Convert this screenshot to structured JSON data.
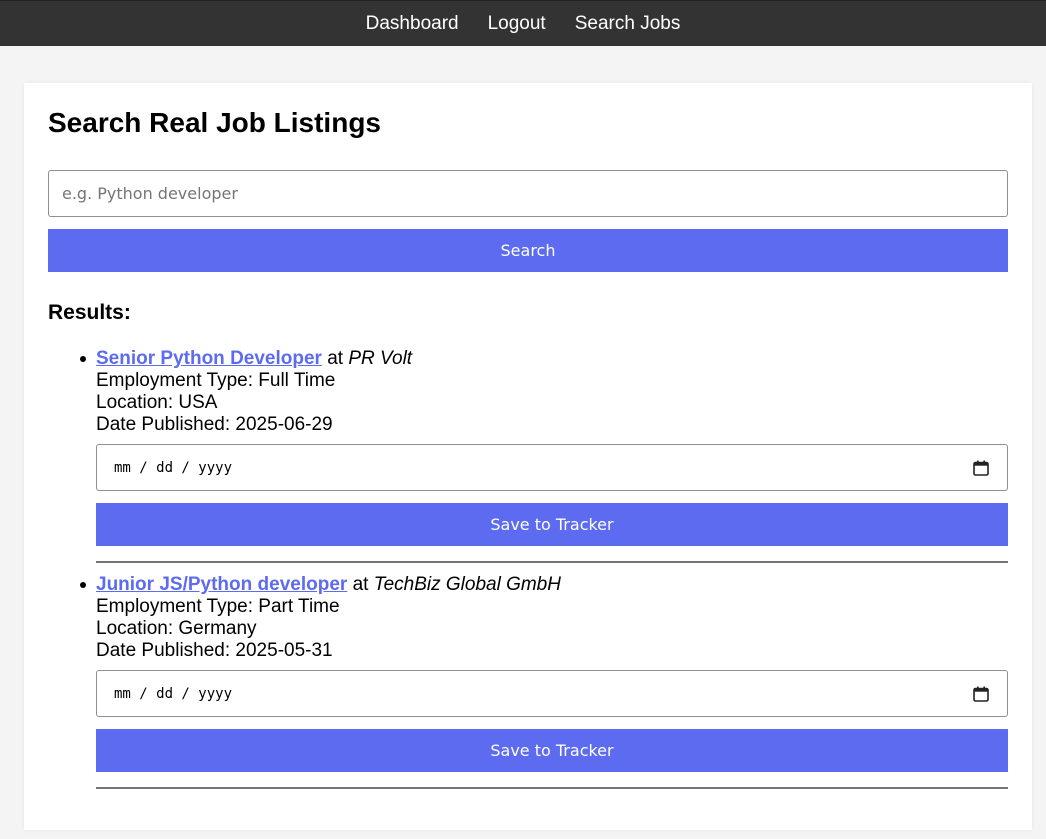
{
  "nav": {
    "dashboard": "Dashboard",
    "logout": "Logout",
    "search_jobs": "Search Jobs"
  },
  "page": {
    "title": "Search Real Job Listings",
    "search_placeholder": "e.g. Python developer",
    "search_button": "Search",
    "results_heading": "Results:"
  },
  "jobs": [
    {
      "title": "Senior Python Developer",
      "at": "at",
      "company": "PR Volt",
      "employment_type": "Employment Type: Full Time",
      "location": "Location: USA",
      "date_published": "Date Published: 2025-06-29",
      "date_placeholder": "mm / dd / yyyy",
      "save_label": "Save to Tracker"
    },
    {
      "title": "Junior JS/Python developer",
      "at": "at",
      "company": "TechBiz Global GmbH",
      "employment_type": "Employment Type: Part Time",
      "location": "Location: Germany",
      "date_published": "Date Published: 2025-05-31",
      "date_placeholder": "mm / dd / yyyy",
      "save_label": "Save to Tracker"
    }
  ],
  "colors": {
    "nav_bg": "#333333",
    "accent": "#5c6bf0",
    "page_bg": "#f4f4f4"
  },
  "icons": {
    "date_picker": "calendar-icon",
    "list_marker": "bullet-icon"
  }
}
